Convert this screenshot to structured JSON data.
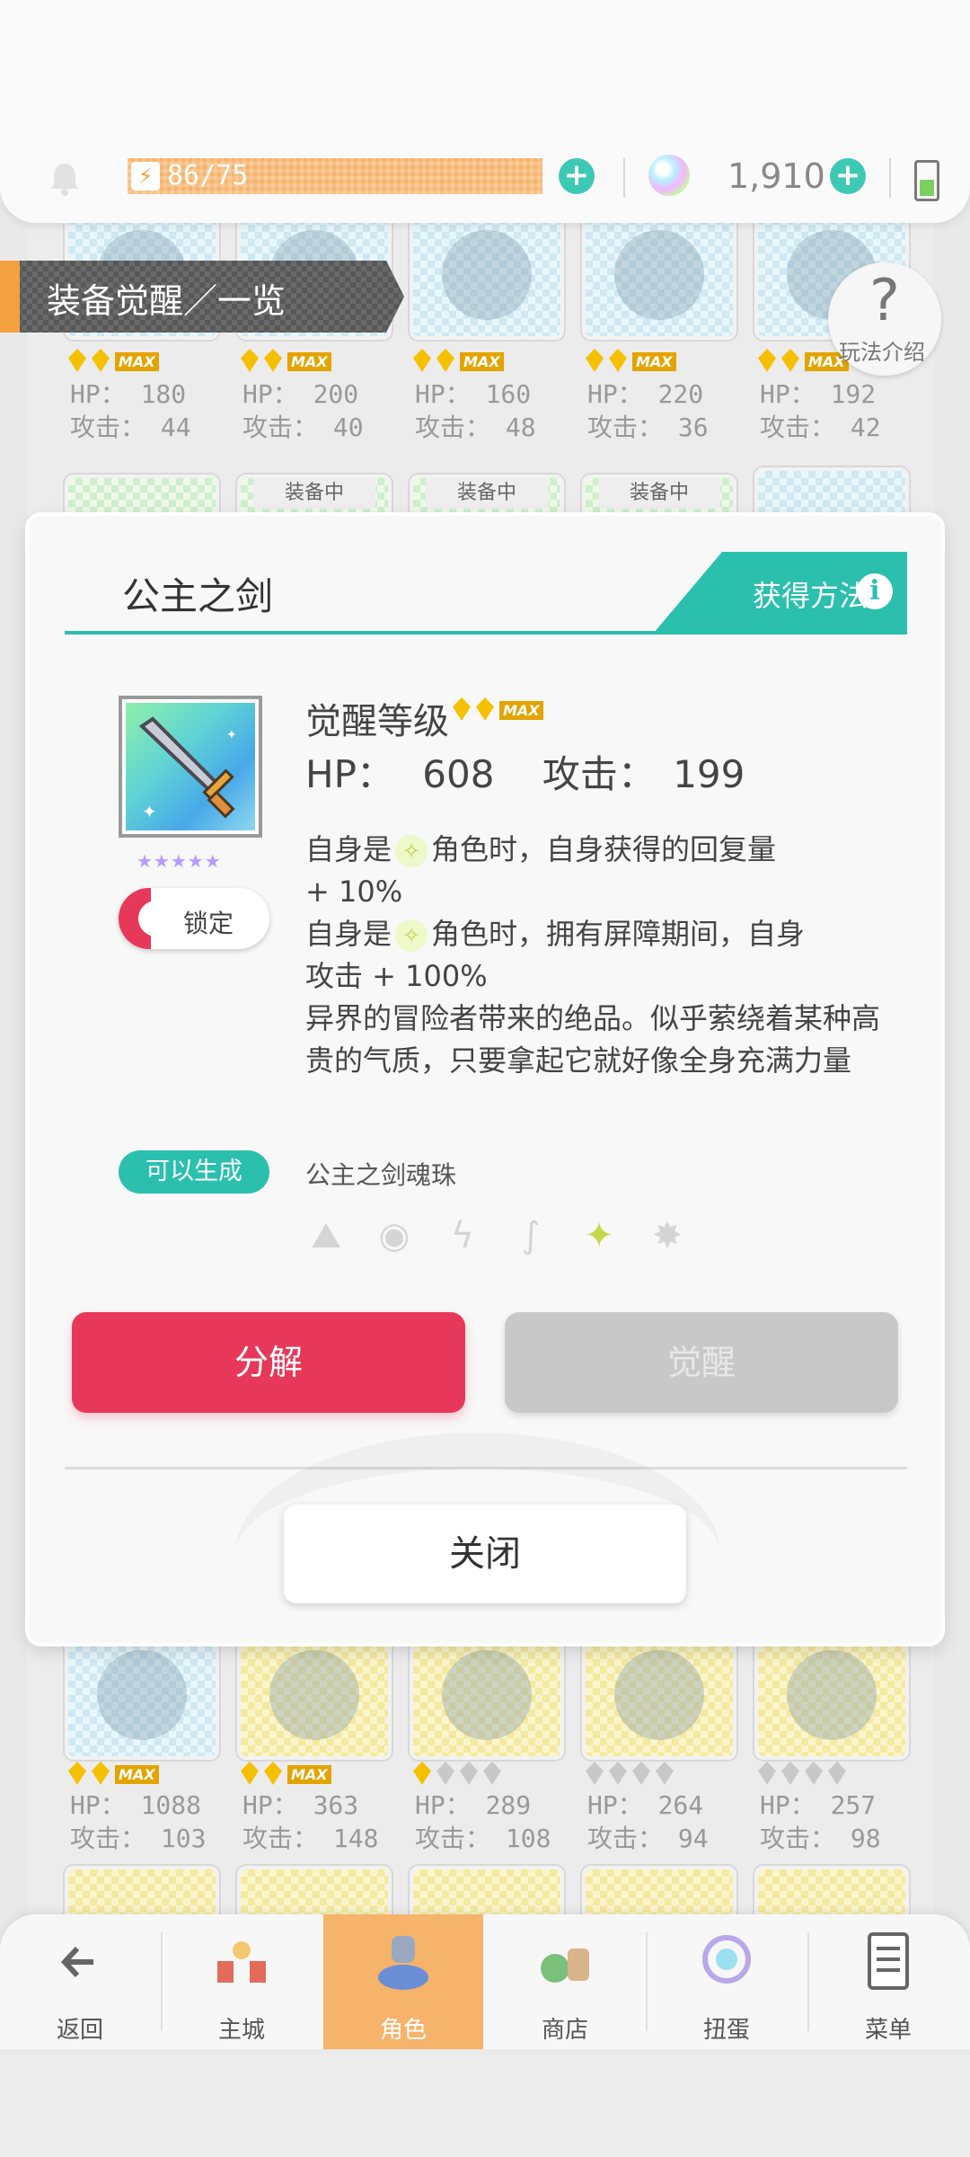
{
  "header": {
    "stamina": "86/75",
    "gems": "1,910"
  },
  "page_title": "装备觉醒／一览",
  "help": {
    "label": "玩法介绍"
  },
  "grid": {
    "row1": [
      {
        "hp": "HP： 180",
        "atk": "攻击： 44"
      },
      {
        "hp": "HP： 200",
        "atk": "攻击： 40"
      },
      {
        "hp": "HP： 160",
        "atk": "攻击： 48"
      },
      {
        "hp": "HP： 220",
        "atk": "攻击： 36"
      },
      {
        "hp": "HP： 192",
        "atk": "攻击： 42"
      }
    ],
    "equipped_label": "装备中",
    "row3": [
      {
        "hp": "HP： 1088",
        "atk": "攻击： 103"
      },
      {
        "hp": "HP： 363",
        "atk": "攻击： 148"
      },
      {
        "hp": "HP： 289",
        "atk": "攻击： 108"
      },
      {
        "hp": "HP： 264",
        "atk": "攻击： 94"
      },
      {
        "hp": "HP： 257",
        "atk": "攻击： 98"
      }
    ],
    "max_label": "MAX"
  },
  "modal": {
    "title": "公主之剑",
    "obtain_label": "获得方法",
    "rarity_stars": "★★★★★",
    "lock_label": "锁定",
    "awaken_level_label": "觉醒等级",
    "hp_label": "HP：",
    "hp_value": "608",
    "atk_label": "攻击：",
    "atk_value": "199",
    "desc": {
      "line1_pre": "自身是",
      "line1_post": "角色时，自身获得的回复量",
      "line2": "+ 10%",
      "line3_pre": "自身是",
      "line3_post": "角色时，拥有屏障期间，自身",
      "line4": "攻击 + 100%",
      "flavor": "异界的冒险者带来的绝品。似乎萦绕着某种高贵的气质，只要拿起它就好像全身充满力量"
    },
    "generate_label": "可以生成",
    "soul_label": "公主之剑魂珠",
    "elements": [
      "earth-icon",
      "orb-icon",
      "lightning-icon",
      "wind-icon",
      "sparkle-icon",
      "dark-icon"
    ],
    "decompose_label": "分解",
    "awaken_label": "觉醒",
    "close_label": "关闭"
  },
  "nav": [
    {
      "label": "返回",
      "icon": "back-arrow-icon"
    },
    {
      "label": "主城",
      "icon": "town-icon"
    },
    {
      "label": "角色",
      "icon": "character-icon",
      "active": true
    },
    {
      "label": "商店",
      "icon": "shop-icon"
    },
    {
      "label": "扭蛋",
      "icon": "gacha-icon"
    },
    {
      "label": "菜单",
      "icon": "menu-icon"
    }
  ],
  "colors": {
    "accent_teal": "#2bbfae",
    "danger_red": "#e8385a",
    "active_orange": "#f6b36a",
    "gem_gold": "#f5c000"
  }
}
